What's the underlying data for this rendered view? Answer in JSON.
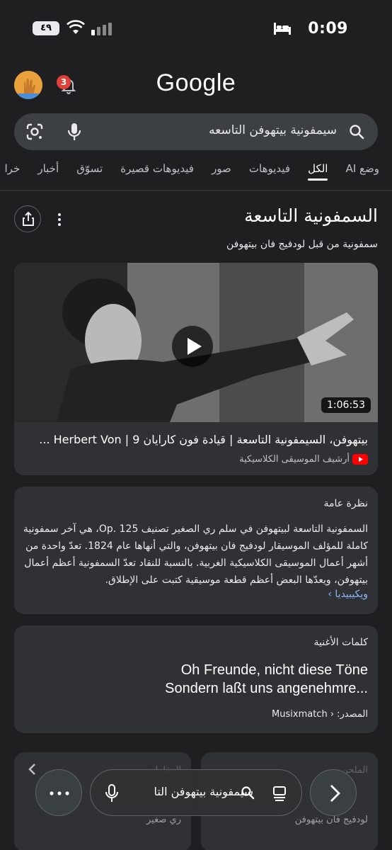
{
  "status_bar": {
    "time": "0:09",
    "battery": "٤٩"
  },
  "header": {
    "logo": "Google",
    "notification_count": "3"
  },
  "search": {
    "query": "سيمفونية بيتهوفن التاسعه"
  },
  "tabs": [
    {
      "label": "وضع AI",
      "active": false
    },
    {
      "label": "الكل",
      "active": true
    },
    {
      "label": "فيديوهات",
      "active": false
    },
    {
      "label": "صور",
      "active": false
    },
    {
      "label": "فيديوهات قصيرة",
      "active": false
    },
    {
      "label": "تسوّق",
      "active": false
    },
    {
      "label": "أخبار",
      "active": false
    },
    {
      "label": "خرا",
      "active": false
    }
  ],
  "knowledge_panel": {
    "title": "السمفونية التاسعة",
    "subtitle": "سمفونية من قبل لودفيج فان بيتهوفن"
  },
  "video": {
    "duration": "1:06:53",
    "title": "بيتهوفن، السيمفونية التاسعة | قيادة فون كارايان Herbert Von | 9 ...",
    "source": "أرشيف الموسيقى الكلاسيكية"
  },
  "overview": {
    "label": "نظرة عامة",
    "text": "السمفونية التاسعة لبيتهوفن في سلم ري الصغير تصنيف 125 .Op، هي آخر سمفونية كاملة للمؤلف الموسيقار لودفيج فان بيتهوفن، والتي أنهاها عام 1824. تعدّ واحدة من أشهر أعمال الموسيقى الكلاسيكية الغربية. بالنسبة للنقاد تعدّ السمفونية أعظم أعمال بيتهوفن، ويعدّها البعض أعظم قطعة موسيقية كتبت على الإطلاق.",
    "link": "ويكيبيديا ›"
  },
  "lyrics": {
    "label": "كلمات الأغنية",
    "line1": "Oh Freunde, nicht diese Töne",
    "line2": "Sondern laßt uns angenehmre...",
    "source": "المصدر: ‹ Musixmatch"
  },
  "bottom_cards": {
    "right_label": "الملحن",
    "right_sub": "لودفيج فان بيتهوفن",
    "left_label": "المقامات",
    "left_sub": "ري صغير"
  },
  "bottom_bar": {
    "query": "سيمفونية بيتهوفن التا"
  }
}
